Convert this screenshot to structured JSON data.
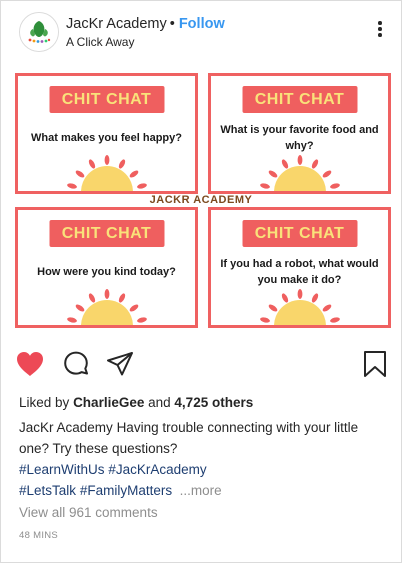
{
  "header": {
    "username": "JacKr Academy",
    "separator": "•",
    "follow_label": "Follow",
    "location": "A Click Away"
  },
  "image": {
    "watermark": "JACKR ACADEMY",
    "cards": [
      {
        "banner": "CHIT CHAT",
        "question": "What makes you feel happy?"
      },
      {
        "banner": "CHIT CHAT",
        "question": "What is your favorite food and why?"
      },
      {
        "banner": "CHIT CHAT",
        "question": "How were you kind today?"
      },
      {
        "banner": "CHIT CHAT",
        "question": "If you had a robot, what would you make it do?"
      }
    ],
    "colors": {
      "card_border": "#ef6161",
      "banner_bg": "#ef5f5f",
      "banner_text": "#f9e27a",
      "sun_body": "#f9d66b",
      "sun_rays": "#ef5f5f"
    }
  },
  "actions": {
    "like_icon": "heart-filled-icon",
    "comment_icon": "comment-bubble-icon",
    "share_icon": "paper-plane-icon",
    "save_icon": "bookmark-icon",
    "like_color": "#ed4956"
  },
  "likes": {
    "prefix": "Liked by",
    "user": "CharlieGee",
    "joiner": "and",
    "count": "4,725 others"
  },
  "caption": {
    "username": "JacKr Academy",
    "text": "Having trouble connecting with your little one? Try these questions?",
    "hashtags_line1": [
      "#LearnWithUs",
      "#JacKrAcademy"
    ],
    "hashtags_line2": [
      "#LetsTalk",
      "#FamilyMatters"
    ],
    "more_label": "...more"
  },
  "comments_link": "View all 961 comments",
  "timestamp": "48 MINS"
}
